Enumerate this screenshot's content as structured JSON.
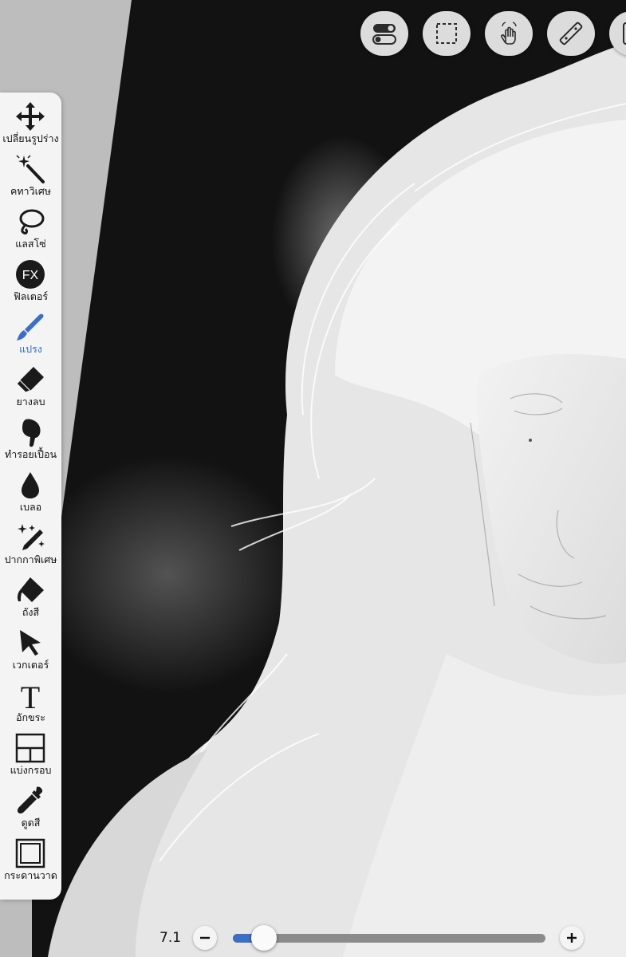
{
  "top_toolbar": {
    "buttons": [
      {
        "icon": "toggle-switch-icon"
      },
      {
        "icon": "dashed-selection-icon"
      },
      {
        "icon": "touch-gesture-icon"
      },
      {
        "icon": "ruler-icon"
      },
      {
        "icon": "layer-panel-icon"
      }
    ]
  },
  "tools": [
    {
      "label": "เปลี่ยนรูปร่าง",
      "icon": "move-arrows-icon",
      "active": false
    },
    {
      "label": "คทาวิเศษ",
      "icon": "magic-wand-icon",
      "active": false
    },
    {
      "label": "แลสโซ่",
      "icon": "lasso-icon",
      "active": false
    },
    {
      "label": "ฟิลเตอร์",
      "icon": "fx-filter-icon",
      "active": false
    },
    {
      "label": "แปรง",
      "icon": "brush-icon",
      "active": true
    },
    {
      "label": "ยางลบ",
      "icon": "eraser-icon",
      "active": false
    },
    {
      "label": "ทำรอยเปื้อน",
      "icon": "smudge-icon",
      "active": false
    },
    {
      "label": "เบลอ",
      "icon": "blur-drop-icon",
      "active": false
    },
    {
      "label": "ปากกาพิเศษ",
      "icon": "special-pen-icon",
      "active": false
    },
    {
      "label": "ถังสี",
      "icon": "paint-bucket-icon",
      "active": false
    },
    {
      "label": "เวกเตอร์",
      "icon": "vector-arrow-icon",
      "active": false
    },
    {
      "label": "อักขระ",
      "icon": "text-icon",
      "active": false
    },
    {
      "label": "แบ่งกรอบ",
      "icon": "frame-divider-icon",
      "active": false
    },
    {
      "label": "ดูดสี",
      "icon": "eyedropper-icon",
      "active": false
    },
    {
      "label": "กระดานวาด",
      "icon": "canvas-icon",
      "active": false
    }
  ],
  "brush_size": {
    "value_label": "7.1",
    "slider_fraction": 0.1,
    "minus_icon": "minus-icon",
    "plus_icon": "plus-icon"
  },
  "colors": {
    "accent": "#3c6ec4",
    "panel": "#f4f4f4",
    "canvas_dark": "#121212"
  }
}
